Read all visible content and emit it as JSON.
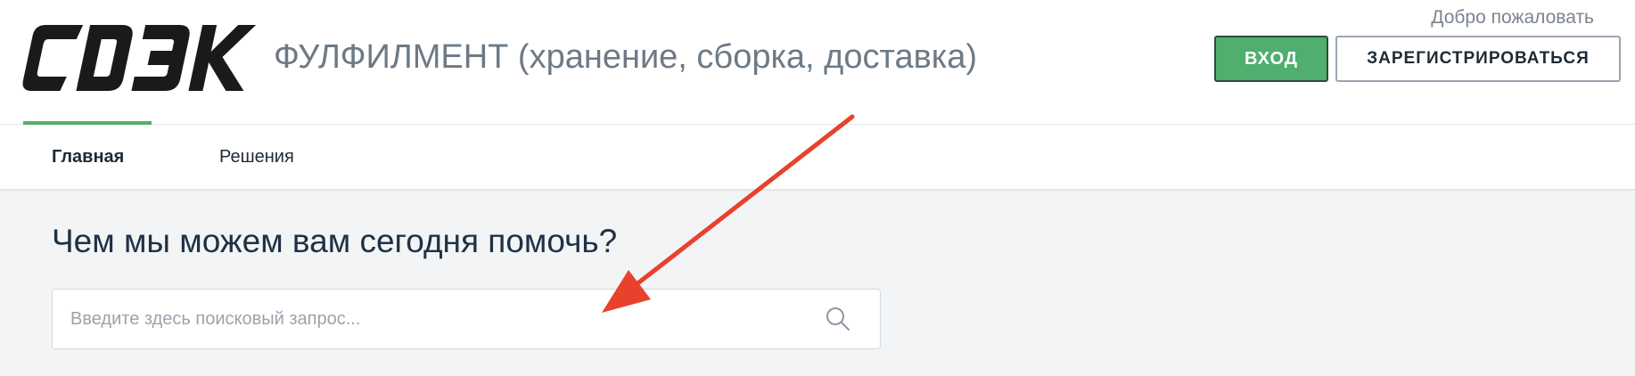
{
  "header": {
    "logo_text": "CDEK",
    "site_title": "ФУЛФИЛМЕНТ (хранение, сборка, доставка)",
    "welcome": "Добро пожаловать",
    "login_label": "ВХОД",
    "register_label": "ЗАРЕГИСТРИРОВАТЬСЯ"
  },
  "nav": {
    "items": [
      {
        "label": "Главная",
        "active": true
      },
      {
        "label": "Решения",
        "active": false
      }
    ]
  },
  "hero": {
    "title": "Чем мы можем вам сегодня помочь?",
    "search": {
      "placeholder": "Введите здесь поисковый запрос...",
      "value": "",
      "icon": "search-icon"
    }
  },
  "annotation": {
    "icon": "arrow-icon",
    "color": "#e8412c"
  },
  "colors": {
    "accent_green": "#50ae6e",
    "logo": "#1a1a1a",
    "title_gray": "#6d7a86",
    "hero_bg": "#f2f4f6"
  }
}
